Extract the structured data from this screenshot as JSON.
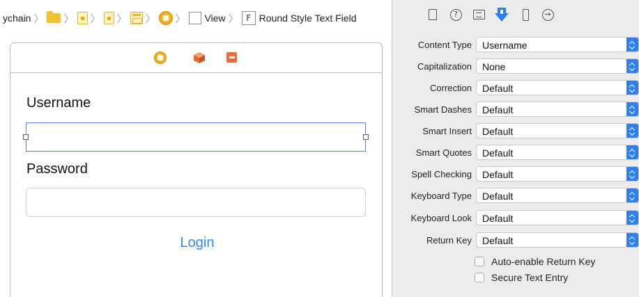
{
  "breadcrumb": {
    "items": [
      {
        "label": "ychain"
      },
      {
        "icon": "folder-icon"
      },
      {
        "icon": "swift-file-icon"
      },
      {
        "icon": "swift-file-icon"
      },
      {
        "icon": "storyboard-icon"
      },
      {
        "icon": "view-controller-icon"
      },
      {
        "icon": "view-icon",
        "label": "View"
      },
      {
        "icon": "text-field-icon",
        "icon_text": "F",
        "label": "Round Style Text Field"
      }
    ]
  },
  "canvas": {
    "dock_icons": [
      "view-controller-icon",
      "first-responder-icon",
      "exit-icon"
    ],
    "username_label": "Username",
    "username_value": "",
    "password_label": "Password",
    "password_value": "",
    "login_label": "Login",
    "login_color": "#2b89f5",
    "selection_color": "#5b7fe0"
  },
  "inspector": {
    "tabs": [
      {
        "icon": "file-icon"
      },
      {
        "icon": "help-icon",
        "glyph": "?"
      },
      {
        "icon": "identity-icon"
      },
      {
        "icon": "attributes-icon",
        "selected": true
      },
      {
        "icon": "size-icon"
      },
      {
        "icon": "connections-icon",
        "glyph": "→"
      }
    ],
    "accent_color": "#2e7ff6",
    "properties": [
      {
        "label": "Content Type",
        "value": "Username"
      },
      {
        "label": "Capitalization",
        "value": "None"
      },
      {
        "label": "Correction",
        "value": "Default"
      },
      {
        "label": "Smart Dashes",
        "value": "Default"
      },
      {
        "label": "Smart Insert",
        "value": "Default"
      },
      {
        "label": "Smart Quotes",
        "value": "Default"
      },
      {
        "label": "Spell Checking",
        "value": "Default"
      },
      {
        "label": "Keyboard Type",
        "value": "Default"
      },
      {
        "label": "Keyboard Look",
        "value": "Default"
      },
      {
        "label": "Return Key",
        "value": "Default"
      }
    ],
    "checkboxes": [
      {
        "label": "Auto-enable Return Key",
        "checked": false
      },
      {
        "label": "Secure Text Entry",
        "checked": false
      }
    ]
  }
}
